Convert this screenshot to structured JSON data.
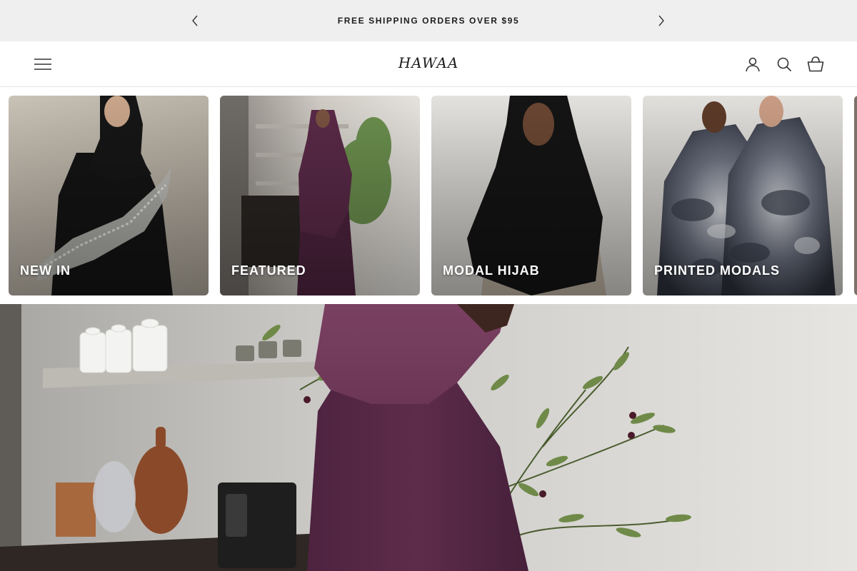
{
  "announcement": {
    "text": "FREE SHIPPING ORDERS OVER $95",
    "prev_icon": "chevron-left-icon",
    "next_icon": "chevron-right-icon"
  },
  "header": {
    "logo": "HAWAA",
    "menu_icon": "hamburger-menu-icon",
    "icons": [
      "account-icon",
      "search-icon",
      "cart-icon"
    ]
  },
  "collections": [
    {
      "label": "NEW IN"
    },
    {
      "label": "FEATURED"
    },
    {
      "label": "MODAL HIJAB"
    },
    {
      "label": "PRINTED MODALS"
    },
    {
      "label": ""
    }
  ],
  "colors": {
    "announcement_bg": "#efefef",
    "text": "#1c1c1c",
    "plum": "#5a2a48",
    "black": "#151515"
  }
}
